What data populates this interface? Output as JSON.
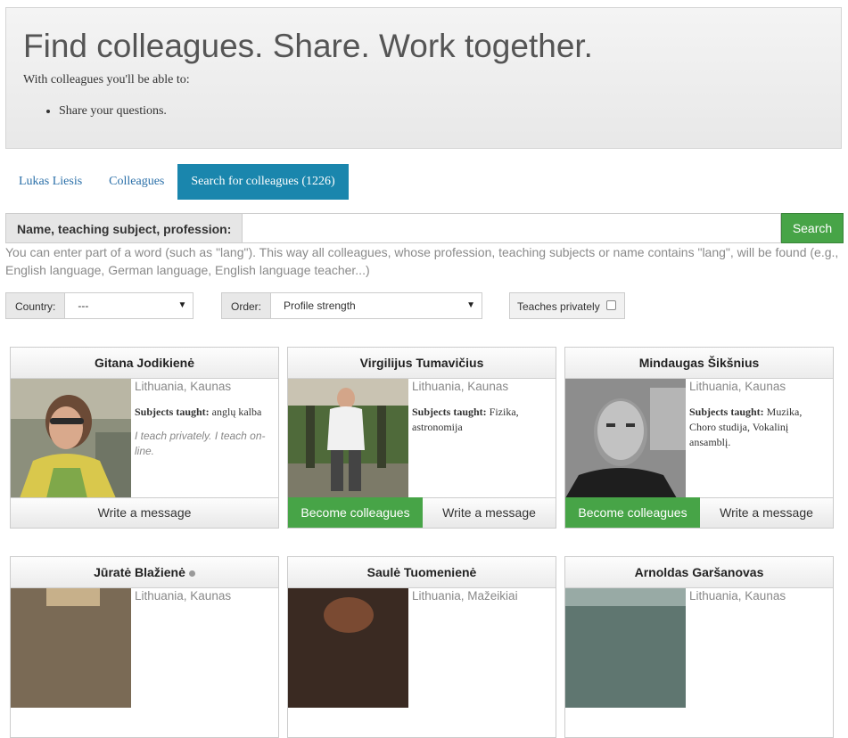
{
  "hero": {
    "title": "Find colleagues. Share. Work together.",
    "intro": "With colleagues you'll be able to:",
    "bullets": [
      "Share your questions."
    ]
  },
  "tabs": [
    {
      "label": "Lukas Liesis",
      "active": false
    },
    {
      "label": "Colleagues",
      "active": false
    },
    {
      "label": "Search for colleagues (1226)",
      "active": true
    }
  ],
  "search": {
    "label": "Name, teaching subject, profession:",
    "value": "",
    "button": "Search",
    "hint": "You can enter part of a word (such as \"lang\"). This way all colleagues, whose profession, teaching subjects or name contains \"lang\", will be found (e.g., English language, German language, English language teacher...)"
  },
  "filters": {
    "country_label": "Country:",
    "country_value": "---",
    "order_label": "Order:",
    "order_value": "Profile strength",
    "privately_label": "Teaches privately"
  },
  "cards": [
    {
      "name": "Gitana Jodikienė",
      "location": "Lithuania, Kaunas",
      "subjects_label": "Subjects taught:",
      "subjects": "anglų kalba",
      "private_note": "I teach privately. I teach on-line.",
      "write": "Write a message"
    },
    {
      "name": "Virgilijus Tumavičius",
      "location": "Lithuania, Kaunas",
      "subjects_label": "Subjects taught:",
      "subjects": "Fizika, astronomija",
      "become": "Become colleagues",
      "write": "Write a message"
    },
    {
      "name": "Mindaugas Šikšnius",
      "location": "Lithuania, Kaunas",
      "subjects_label": "Subjects taught:",
      "subjects": "Muzika, Choro studija, Vokalinį ansamblį.",
      "become": "Become colleagues",
      "write": "Write a message"
    },
    {
      "name": "Jūratė Blažienė",
      "location": "Lithuania, Kaunas"
    },
    {
      "name": "Saulė Tuomenienė",
      "location": "Lithuania, Mažeikiai"
    },
    {
      "name": "Arnoldas Garšanovas",
      "location": "Lithuania, Kaunas"
    }
  ]
}
